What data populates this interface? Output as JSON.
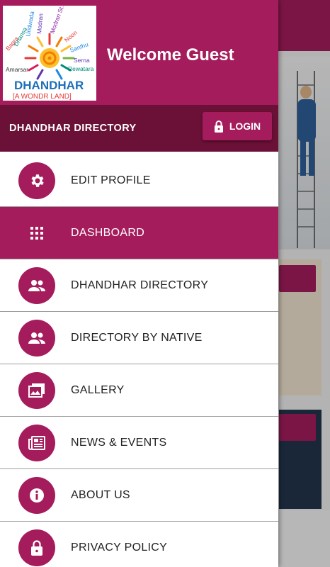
{
  "header": {
    "welcome": "Welcome Guest",
    "logo": {
      "brand": "DHANDHAR",
      "tagline": "[A WONDR LAND]",
      "villages": [
        "Bagra",
        "Bagra",
        "Dhansa",
        "Undwada",
        "Modran",
        "Modran St.",
        "Noon",
        "Santhu",
        "Serna",
        "Rewatara",
        "Amarsar",
        "Jodwada",
        "Bor"
      ]
    }
  },
  "directory_bar": {
    "title": "DHANDHAR DIRECTORY",
    "login_label": "LOGIN"
  },
  "menu": {
    "items": [
      {
        "label": "EDIT PROFILE",
        "icon": "gear-icon"
      },
      {
        "label": "DASHBOARD",
        "icon": "grid-icon"
      },
      {
        "label": "DHANDHAR DIRECTORY",
        "icon": "people-icon"
      },
      {
        "label": "DIRECTORY BY NATIVE",
        "icon": "people-icon"
      },
      {
        "label": "GALLERY",
        "icon": "gallery-icon"
      },
      {
        "label": "NEWS & EVENTS",
        "icon": "newspaper-icon"
      },
      {
        "label": "ABOUT US",
        "icon": "info-icon"
      },
      {
        "label": "PRIVACY POLICY",
        "icon": "lock-icon"
      }
    ],
    "active": "DASHBOARD"
  },
  "colors": {
    "primary": "#a51c5c",
    "dark": "#6b1036",
    "white": "#ffffff"
  }
}
